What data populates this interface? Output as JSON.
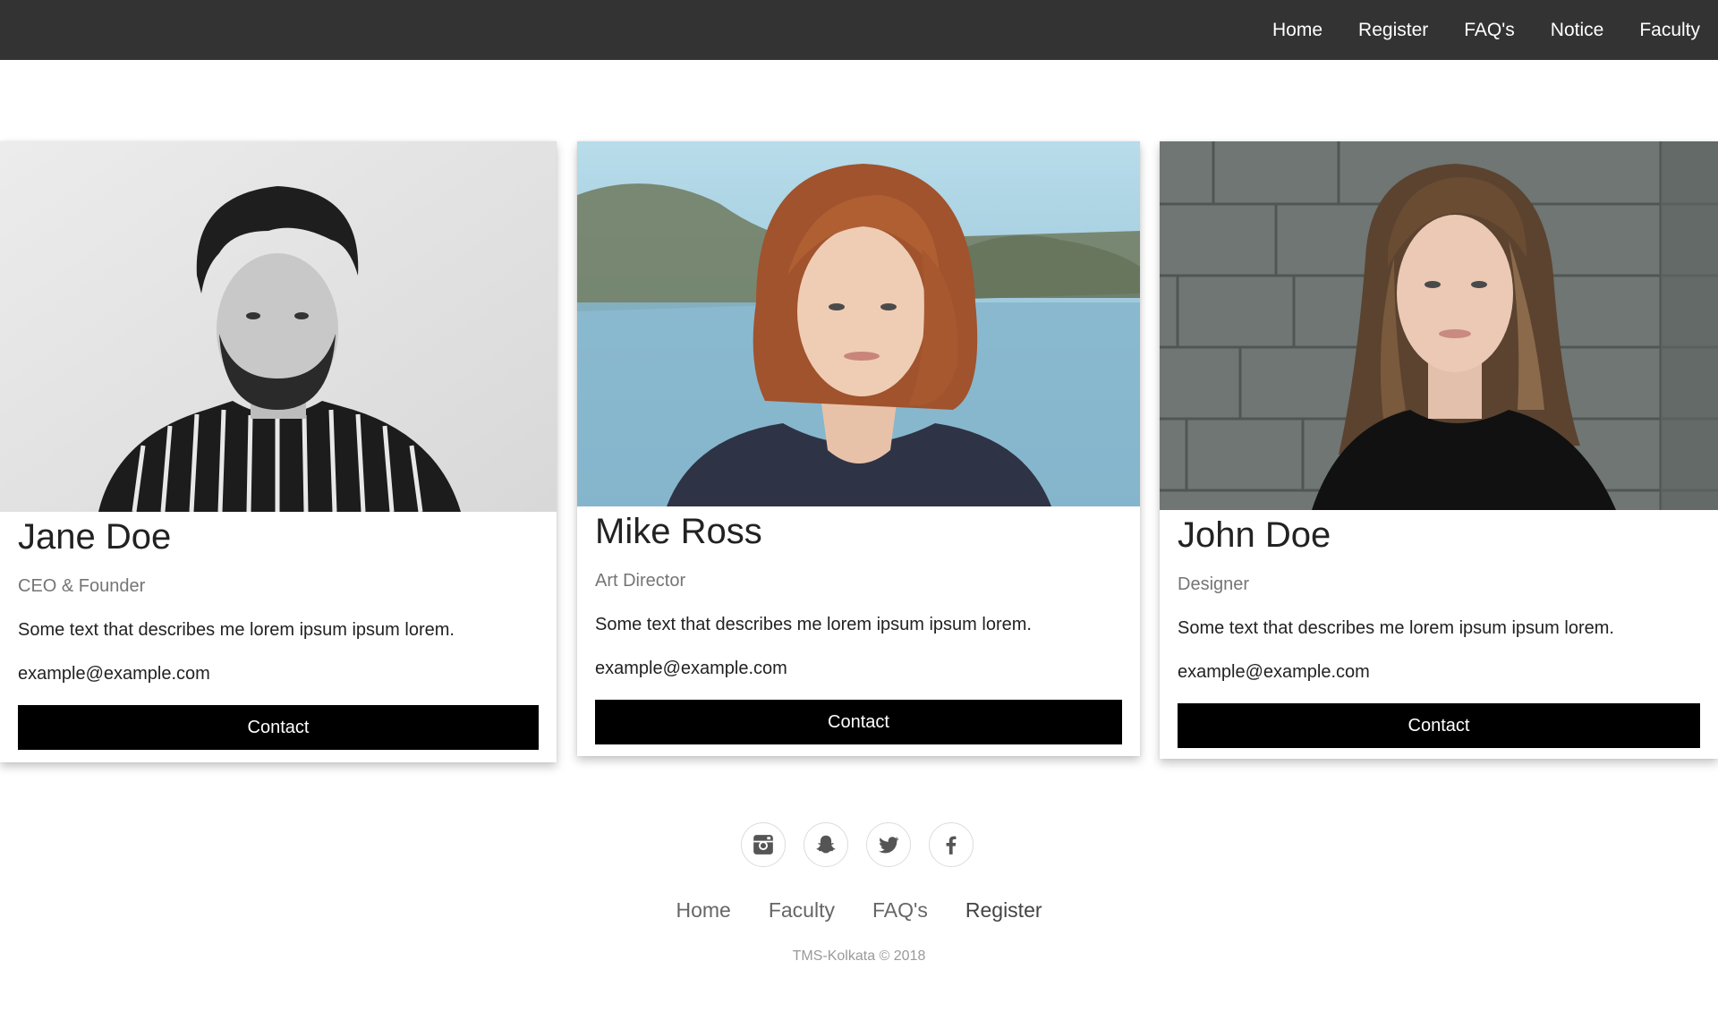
{
  "nav": {
    "links": [
      "Home",
      "Register",
      "FAQ's",
      "Notice",
      "Faculty"
    ]
  },
  "cards": [
    {
      "name": "Jane Doe",
      "title": "CEO & Founder",
      "description": "Some text that describes me lorem ipsum ipsum lorem.",
      "email": "example@example.com",
      "button_label": "Contact"
    },
    {
      "name": "Mike Ross",
      "title": "Art Director",
      "description": "Some text that describes me lorem ipsum ipsum lorem.",
      "email": "example@example.com",
      "button_label": "Contact"
    },
    {
      "name": "John Doe",
      "title": "Designer",
      "description": "Some text that describes me lorem ipsum ipsum lorem.",
      "email": "example@example.com",
      "button_label": "Contact"
    }
  ],
  "social": {
    "icons": [
      "instagram-icon",
      "snapchat-icon",
      "twitter-icon",
      "facebook-icon"
    ]
  },
  "footer": {
    "links": [
      "Home",
      "Faculty",
      "FAQ's",
      "Register"
    ],
    "copyright": "TMS-Kolkata © 2018"
  },
  "colors": {
    "nav_background": "#333333",
    "button_background": "#000000",
    "muted_text": "#757575"
  }
}
